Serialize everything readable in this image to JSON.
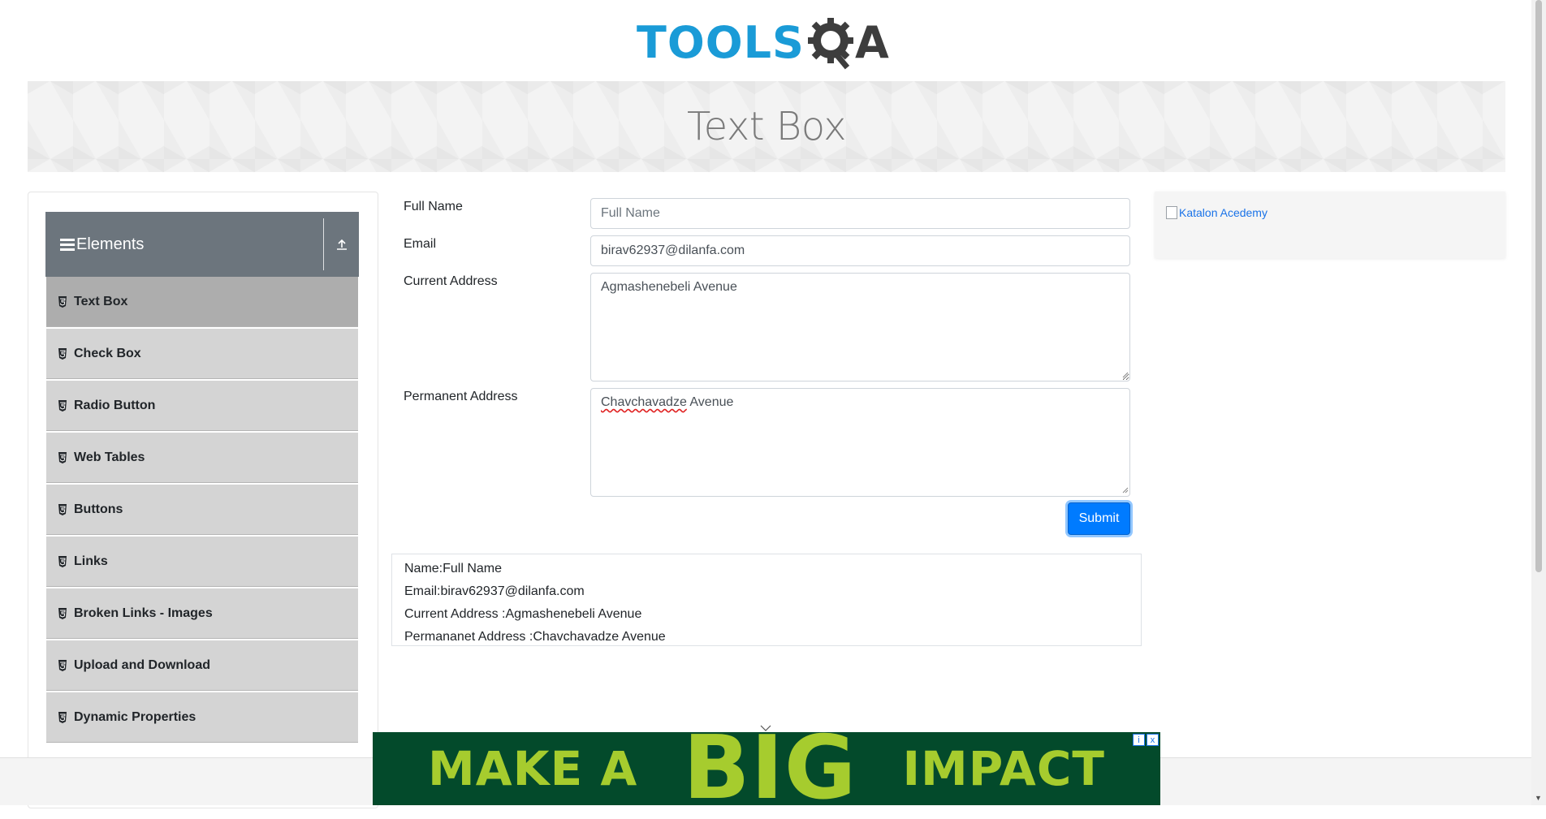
{
  "header": {
    "logo_text_tools": "TOOLS",
    "logo_text_a": "A",
    "logo_brand_color": "#1a9bd7"
  },
  "banner": {
    "title": "Text Box"
  },
  "sidebar": {
    "group_title": "Elements",
    "group_icon": "hamburger-icon",
    "collapse_icon": "collapse-up-icon",
    "items": [
      {
        "label": "Text Box",
        "active": true
      },
      {
        "label": "Check Box"
      },
      {
        "label": "Radio Button"
      },
      {
        "label": "Web Tables"
      },
      {
        "label": "Buttons"
      },
      {
        "label": "Links"
      },
      {
        "label": "Broken Links - Images"
      },
      {
        "label": "Upload and Download"
      },
      {
        "label": "Dynamic Properties"
      }
    ],
    "active_bg": "#adadad",
    "item_bg": "#d4d4d4"
  },
  "form": {
    "full_name_label": "Full Name",
    "full_name_placeholder": "Full Name",
    "full_name_value": "",
    "email_label": "Email",
    "email_value": "birav62937@dilanfa.com",
    "current_address_label": "Current Address",
    "current_address_value": "Agmashenebeli Avenue",
    "permanent_address_label": "Permanent Address",
    "permanent_address_word1": "Chavchavadze",
    "permanent_address_word2": " Avenue",
    "submit_label": "Submit",
    "submit_color": "#007bff"
  },
  "output": {
    "name": "Name:Full Name",
    "email": "Email:birav62937@dilanfa.com",
    "current_address": "Current Address :Agmashenebeli Avenue",
    "permanent_address": "Permananet Address :Chavchavadze Avenue"
  },
  "side_ad": {
    "alt_text": "Katalon Acedemy"
  },
  "bottom_ad": {
    "word1": "MAKE A",
    "word2": "BIG",
    "word3": "IMPACT",
    "info_icon": "i",
    "close_icon": "x",
    "bg_color": "#034a2b",
    "text_color": "#a6cc2e"
  }
}
